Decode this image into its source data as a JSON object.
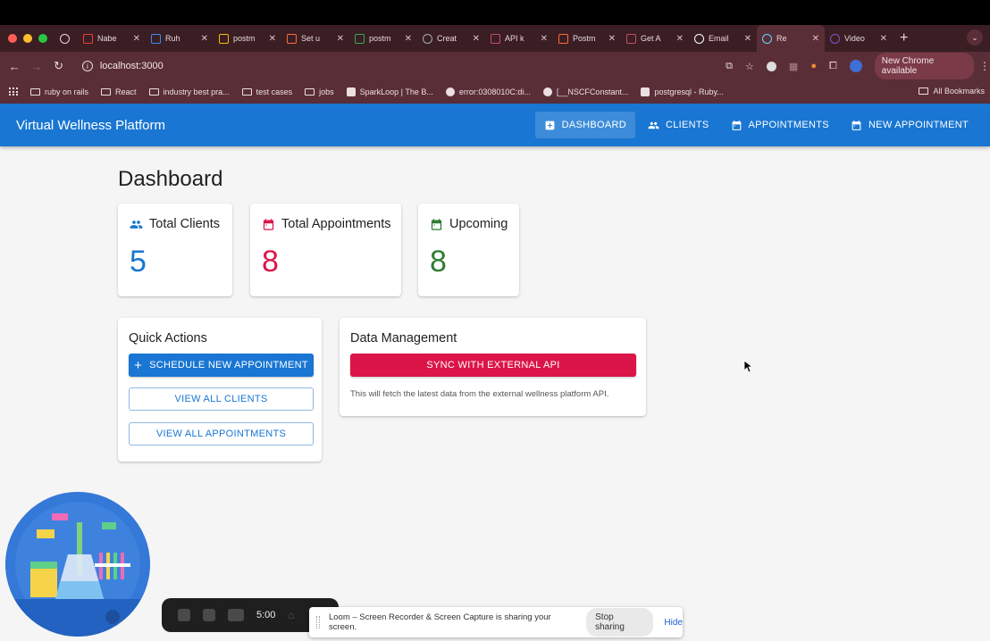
{
  "browser": {
    "tabs": [
      {
        "title": "",
        "icon": "recording-icon",
        "color": "#e8d9dc"
      },
      {
        "title": "Nabe",
        "icon": "gmail-icon",
        "color": "#ea4335"
      },
      {
        "title": "Ruh",
        "icon": "docs-icon",
        "color": "#4285f4"
      },
      {
        "title": "postm",
        "icon": "drive-icon",
        "color": "#fbbc04"
      },
      {
        "title": "Set u",
        "icon": "postman-icon",
        "color": "#ff6c37"
      },
      {
        "title": "postm",
        "icon": "drive-icon",
        "color": "#34a853"
      },
      {
        "title": "Creat",
        "icon": "openai-icon",
        "color": "#aaaaaa"
      },
      {
        "title": "API k",
        "icon": "api-icon",
        "color": "#c24d68"
      },
      {
        "title": "Postm",
        "icon": "postman-icon",
        "color": "#ff6c37"
      },
      {
        "title": "Get A",
        "icon": "page-icon",
        "color": "#c24d68"
      },
      {
        "title": "Email",
        "icon": "github-icon",
        "color": "#ffffff"
      },
      {
        "title": "Re",
        "icon": "react-icon",
        "color": "#61dafb",
        "active": true
      },
      {
        "title": "Video",
        "icon": "video-icon",
        "color": "#7e57c2"
      }
    ],
    "url": "localhost:3000",
    "update_label": "New Chrome available",
    "bookmarks": [
      {
        "label": "ruby on rails",
        "icon": "folder"
      },
      {
        "label": "React",
        "icon": "folder"
      },
      {
        "label": "industry best pra...",
        "icon": "folder"
      },
      {
        "label": "test cases",
        "icon": "folder"
      },
      {
        "label": "jobs",
        "icon": "folder"
      },
      {
        "label": "SparkLoop | The B...",
        "icon": "page"
      },
      {
        "label": "error:0308010C:di...",
        "icon": "github"
      },
      {
        "label": "[__NSCFConstant...",
        "icon": "github"
      },
      {
        "label": "postgresql - Ruby...",
        "icon": "page"
      }
    ],
    "all_bookmarks": "All Bookmarks"
  },
  "app": {
    "brand": "Virtual Wellness Platform",
    "nav": [
      {
        "label": "DASHBOARD",
        "icon": "plus-box-icon",
        "active": true
      },
      {
        "label": "CLIENTS",
        "icon": "people-icon"
      },
      {
        "label": "APPOINTMENTS",
        "icon": "calendar-icon"
      },
      {
        "label": "NEW APPOINTMENT",
        "icon": "calendar-icon"
      }
    ]
  },
  "dashboard": {
    "title": "Dashboard",
    "stats": [
      {
        "label": "Total Clients",
        "value": "5",
        "color": "#1976d2",
        "icon": "people-icon"
      },
      {
        "label": "Total Appointments",
        "value": "8",
        "color": "#dc1548",
        "icon": "calendar-icon"
      },
      {
        "label": "Upcoming",
        "value": "8",
        "color": "#2e7d32",
        "icon": "calendar-icon"
      }
    ],
    "quick_actions": {
      "title": "Quick Actions",
      "schedule": "SCHEDULE NEW APPOINTMENT",
      "view_clients": "VIEW ALL CLIENTS",
      "view_appointments": "VIEW ALL APPOINTMENTS"
    },
    "data_management": {
      "title": "Data Management",
      "sync": "SYNC WITH EXTERNAL API",
      "helper": "This will fetch the latest data from the external wellness platform API."
    }
  },
  "loom": {
    "timer": "5:00",
    "share_message": "Loom – Screen Recorder & Screen Capture is sharing your screen.",
    "stop_label": "Stop sharing",
    "hide_label": "Hide"
  }
}
